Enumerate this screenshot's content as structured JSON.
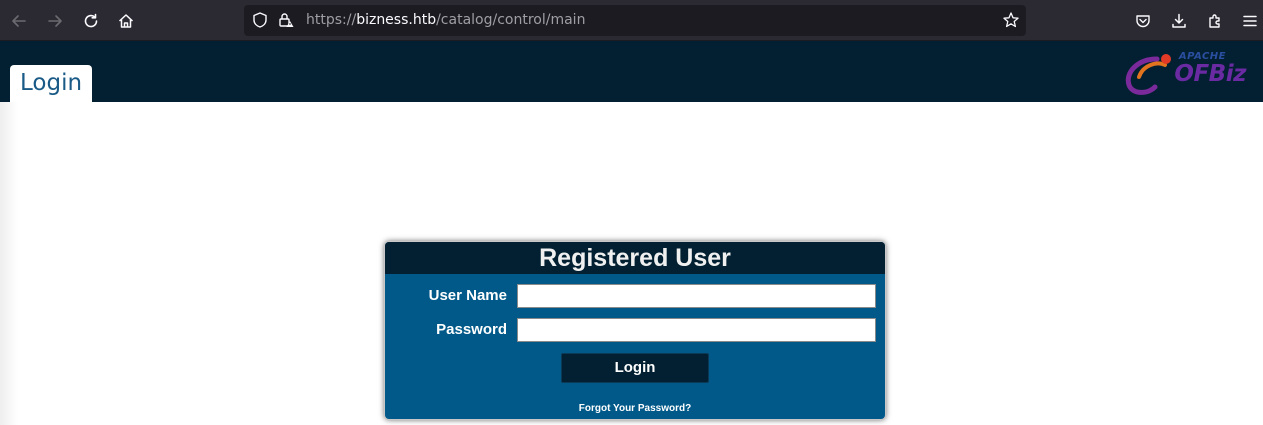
{
  "browser": {
    "url_scheme": "https://",
    "url_host": "bizness.htb",
    "url_path": "/catalog/control/main",
    "icons": [
      "back-arrow-icon",
      "forward-arrow-icon",
      "reload-icon",
      "home-icon",
      "shield-icon",
      "lock-warning-icon",
      "bookmark-star-icon",
      "pocket-icon",
      "download-icon",
      "extensions-icon",
      "menu-icon"
    ]
  },
  "header": {
    "tab_label": "Login",
    "logo_small": "APACHE",
    "logo_main": "OFBiz"
  },
  "login": {
    "title": "Registered User",
    "username_label": "User Name",
    "username_value": "",
    "password_label": "Password",
    "password_value": "",
    "submit_label": "Login",
    "forgot_label": "Forgot Your Password?"
  },
  "colors": {
    "header_bg": "#022031",
    "box_bg": "#015989",
    "tab_text": "#1a5a86"
  }
}
